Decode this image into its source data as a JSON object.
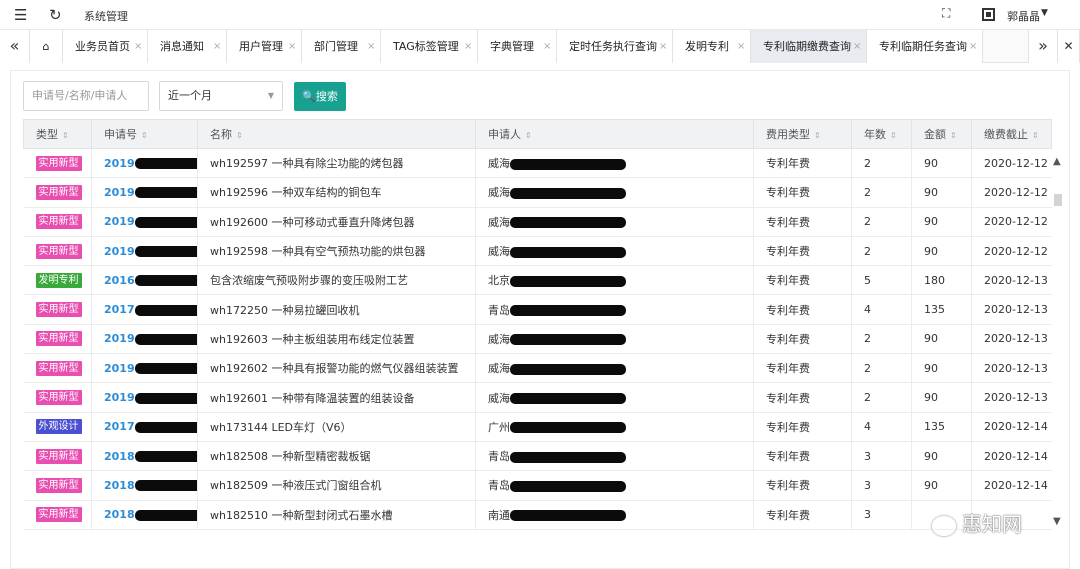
{
  "header": {
    "title": "系统管理",
    "user_name": "郭晶晶",
    "menu_icon": "menu-icon",
    "refresh_icon": "refresh-icon"
  },
  "tabs": [
    {
      "label": "业务员首页"
    },
    {
      "label": "消息通知"
    },
    {
      "label": "用户管理"
    },
    {
      "label": "部门管理"
    },
    {
      "label": "TAG标签管理"
    },
    {
      "label": "字典管理"
    },
    {
      "label": "定时任务执行查询"
    },
    {
      "label": "发明专利"
    },
    {
      "label": "专利临期缴费查询",
      "active": true
    },
    {
      "label": "专利临期任务查询"
    }
  ],
  "filters": {
    "search_placeholder": "申请号/名称/申请人",
    "date_range": "近一个月",
    "search_button": "搜索"
  },
  "table": {
    "headers": [
      "类型",
      "申请号",
      "名称",
      "申请人",
      "费用类型",
      "年数",
      "金额",
      "缴费截止"
    ],
    "rows": [
      {
        "type": "实用新型",
        "type_color": "#e84fb1",
        "app_no": "2019",
        "name": "wh192597 一种具有除尘功能的烤包器",
        "applicant": "威海",
        "fee_type": "专利年费",
        "years": "2",
        "amount": "90",
        "deadline": "2020-12-12"
      },
      {
        "type": "实用新型",
        "type_color": "#e84fb1",
        "app_no": "2019",
        "name": "wh192596 一种双车结构的铜包车",
        "applicant": "威海",
        "fee_type": "专利年费",
        "years": "2",
        "amount": "90",
        "deadline": "2020-12-12"
      },
      {
        "type": "实用新型",
        "type_color": "#e84fb1",
        "app_no": "2019",
        "name": "wh192600 一种可移动式垂直升降烤包器",
        "applicant": "威海",
        "fee_type": "专利年费",
        "years": "2",
        "amount": "90",
        "deadline": "2020-12-12"
      },
      {
        "type": "实用新型",
        "type_color": "#e84fb1",
        "app_no": "2019",
        "name": "wh192598 一种具有空气预热功能的烘包器",
        "applicant": "威海",
        "fee_type": "专利年费",
        "years": "2",
        "amount": "90",
        "deadline": "2020-12-12"
      },
      {
        "type": "发明专利",
        "type_color": "#3aa83a",
        "app_no": "2016",
        "name": "包含浓缩废气预吸附步骤的变压吸附工艺",
        "applicant": "北京",
        "fee_type": "专利年费",
        "years": "5",
        "amount": "180",
        "deadline": "2020-12-13"
      },
      {
        "type": "实用新型",
        "type_color": "#e84fb1",
        "app_no": "2017",
        "name": "wh172250 一种易拉罐回收机",
        "applicant": "青岛",
        "fee_type": "专利年费",
        "years": "4",
        "amount": "135",
        "deadline": "2020-12-13"
      },
      {
        "type": "实用新型",
        "type_color": "#e84fb1",
        "app_no": "2019",
        "name": "wh192603 一种主板组装用布线定位装置",
        "applicant": "威海",
        "fee_type": "专利年费",
        "years": "2",
        "amount": "90",
        "deadline": "2020-12-13"
      },
      {
        "type": "实用新型",
        "type_color": "#e84fb1",
        "app_no": "2019",
        "name": "wh192602 一种具有报警功能的燃气仪器组装装置",
        "applicant": "威海",
        "fee_type": "专利年费",
        "years": "2",
        "amount": "90",
        "deadline": "2020-12-13"
      },
      {
        "type": "实用新型",
        "type_color": "#e84fb1",
        "app_no": "2019",
        "name": "wh192601 一种带有降温装置的组装设备",
        "applicant": "威海",
        "fee_type": "专利年费",
        "years": "2",
        "amount": "90",
        "deadline": "2020-12-13"
      },
      {
        "type": "外观设计",
        "type_color": "#4b4fd1",
        "app_no": "2017",
        "name": "wh173144 LED车灯（V6）",
        "applicant": "广州",
        "fee_type": "专利年费",
        "years": "4",
        "amount": "135",
        "deadline": "2020-12-14"
      },
      {
        "type": "实用新型",
        "type_color": "#e84fb1",
        "app_no": "2018",
        "name": "wh182508 一种新型精密裁板锯",
        "applicant": "青岛",
        "fee_type": "专利年费",
        "years": "3",
        "amount": "90",
        "deadline": "2020-12-14"
      },
      {
        "type": "实用新型",
        "type_color": "#e84fb1",
        "app_no": "2018",
        "name": "wh182509 一种液压式门窗组合机",
        "applicant": "青岛",
        "fee_type": "专利年费",
        "years": "3",
        "amount": "90",
        "deadline": "2020-12-14"
      },
      {
        "type": "实用新型",
        "type_color": "#e84fb1",
        "app_no": "2018",
        "name": "wh182510 一种新型封闭式石墨水槽",
        "applicant": "南通",
        "fee_type": "专利年费",
        "years": "3",
        "amount": "",
        "deadline": ""
      }
    ]
  },
  "watermark": "惠知网"
}
